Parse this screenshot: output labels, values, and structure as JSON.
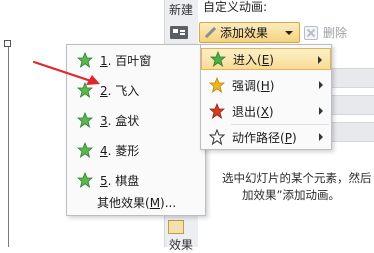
{
  "side_tab": {
    "top_label": "新建",
    "bottom_label": "效果"
  },
  "pane": {
    "title": "自定义动画:",
    "add_effect_label": "添加效果",
    "delete_label": "删除",
    "hint_line1": "选中幻灯片的某个元素，然后",
    "hint_line2": "加效果”添加动画。"
  },
  "entrance_menu": {
    "items": [
      {
        "num": "1",
        "label": ". 百叶窗",
        "icon": "entrance-star-icon"
      },
      {
        "num": "2",
        "label": ". 飞入",
        "icon": "entrance-star-icon"
      },
      {
        "num": "3",
        "label": ". 盒状",
        "icon": "entrance-star-icon"
      },
      {
        "num": "4",
        "label": ". 菱形",
        "icon": "entrance-star-icon"
      },
      {
        "num": "5",
        "label": ". 棋盘",
        "icon": "entrance-star-icon"
      }
    ],
    "more_label_main": "其他效果(",
    "more_key": "M",
    "more_label_tail": ")..."
  },
  "effect_type_menu": {
    "items": [
      {
        "label_main": "进入(",
        "key": "E",
        "label_tail": ")",
        "icon": "green-star-icon",
        "highlighted": true
      },
      {
        "label_main": "强调(",
        "key": "H",
        "label_tail": ")",
        "icon": "yellow-star-icon",
        "highlighted": false
      },
      {
        "label_main": "退出(",
        "key": "X",
        "label_tail": ")",
        "icon": "red-star-icon",
        "highlighted": false
      },
      {
        "label_main": "动作路径(",
        "key": "P",
        "label_tail": ")",
        "icon": "outline-star-icon",
        "highlighted": false
      }
    ]
  },
  "colors": {
    "accent_highlight": "#f8dc95",
    "pointer_arrow": "#e0262b",
    "entrance_star": "#4caf3f",
    "emphasis_star": "#f2b51b",
    "exit_star": "#d23f1e"
  }
}
